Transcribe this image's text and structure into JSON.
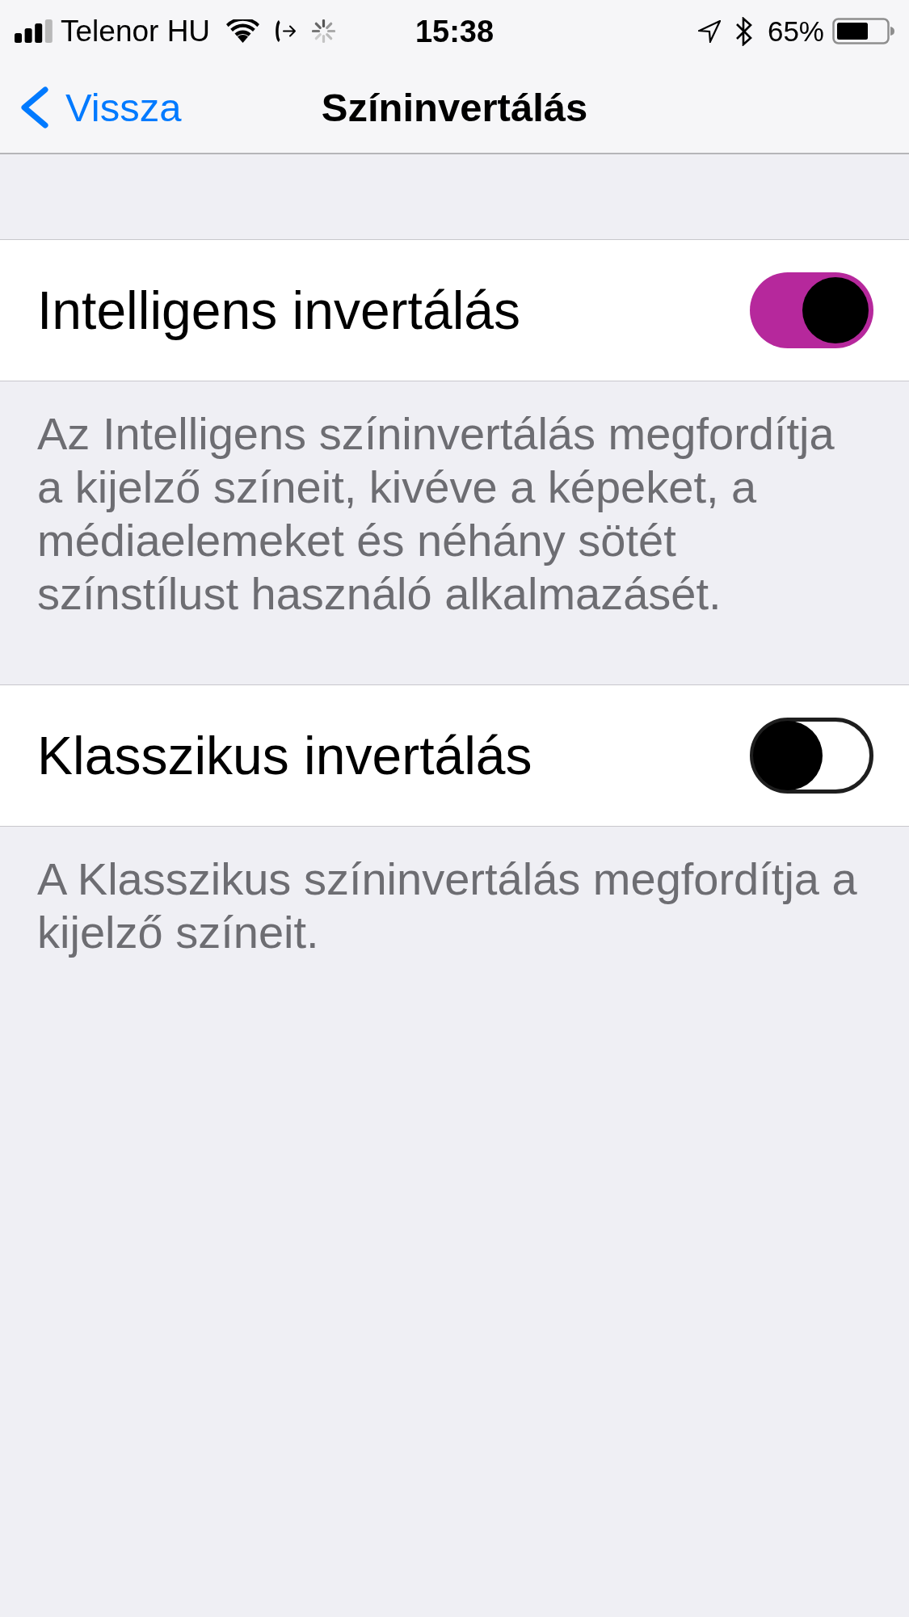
{
  "status_bar": {
    "carrier": "Telenor HU",
    "time": "15:38",
    "battery_text": "65%"
  },
  "nav": {
    "back": "Vissza",
    "title": "Színinvertálás"
  },
  "settings": [
    {
      "label": "Intelligens invertálás",
      "on": true,
      "footer": "Az Intelligens színinvertálás megfordítja a kijelző színeit, kivéve a képeket, a médiaelemeket és néhány sötét színstílust használó alkalmazásét."
    },
    {
      "label": "Klasszikus invertálás",
      "on": false,
      "footer": "A Klasszikus színinvertálás megfordítja a kijelző színeit."
    }
  ]
}
